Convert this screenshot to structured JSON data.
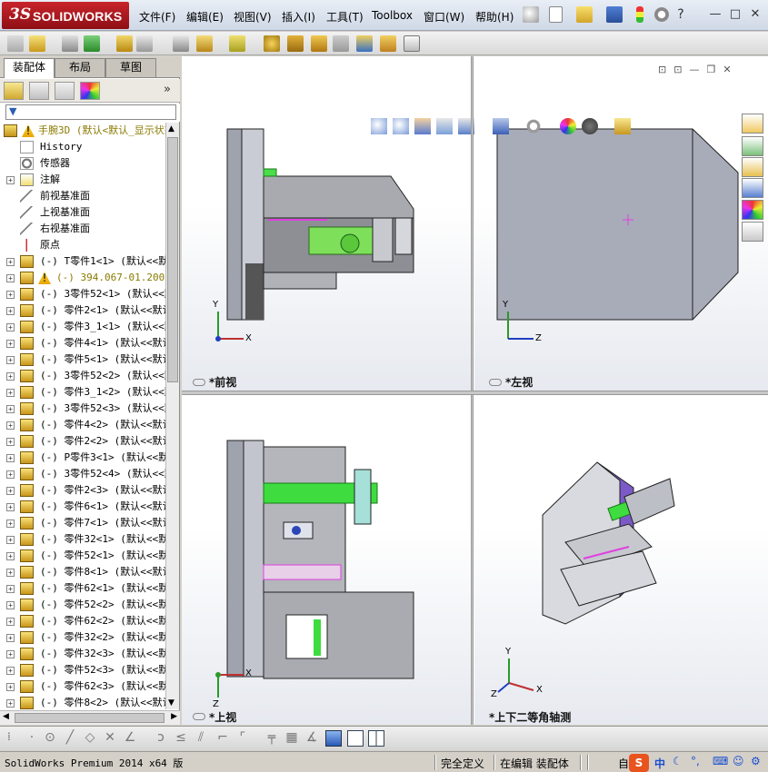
{
  "app": {
    "logo_ds": "3S",
    "logo_text": "SOLIDWORKS"
  },
  "menu": [
    {
      "label": "文件(F)"
    },
    {
      "label": "编辑(E)"
    },
    {
      "label": "视图(V)"
    },
    {
      "label": "插入(I)"
    },
    {
      "label": "工具(T)"
    },
    {
      "label": "Toolbox"
    },
    {
      "label": "窗口(W)"
    },
    {
      "label": "帮助(H)"
    }
  ],
  "window_controls": {
    "minimize": "—",
    "restore": "□",
    "close": "✕"
  },
  "panel_tabs": [
    {
      "label": "装配体",
      "active": true
    },
    {
      "label": "布局",
      "active": false
    },
    {
      "label": "草图",
      "active": false
    }
  ],
  "feature_tree": {
    "root": {
      "label": "手腕3D  (默认<默认_显示状态>",
      "icon": "assembly-warning-icon"
    },
    "items": [
      {
        "label": "History",
        "icon": "history-icon",
        "indent": 1,
        "expander": false
      },
      {
        "label": "传感器",
        "icon": "sensor-icon",
        "indent": 1,
        "expander": false
      },
      {
        "label": "注解",
        "icon": "annotation-icon",
        "indent": 1,
        "expander": true
      },
      {
        "label": "前视基准面",
        "icon": "plane-icon",
        "indent": 1,
        "expander": false
      },
      {
        "label": "上视基准面",
        "icon": "plane-icon",
        "indent": 1,
        "expander": false
      },
      {
        "label": "右视基准面",
        "icon": "plane-icon",
        "indent": 1,
        "expander": false
      },
      {
        "label": "原点",
        "icon": "origin-icon",
        "indent": 1,
        "expander": false
      },
      {
        "label": "(-) T零件1<1> (默认<<默",
        "icon": "part-icon",
        "indent": 1,
        "expander": true
      },
      {
        "label": "(-) 394.067-01.200.5(",
        "icon": "part-warning-icon",
        "indent": 1,
        "expander": true,
        "warning": true
      },
      {
        "label": "(-) 3零件52<1> (默认<<默",
        "icon": "part-icon",
        "indent": 1,
        "expander": true
      },
      {
        "label": "(-) 零件2<1> (默认<<默认",
        "icon": "part-icon",
        "indent": 1,
        "expander": true
      },
      {
        "label": "(-) 零件3_1<1> (默认<<默",
        "icon": "part-icon",
        "indent": 1,
        "expander": true
      },
      {
        "label": "(-) 零件4<1> (默认<<默认",
        "icon": "part-icon",
        "indent": 1,
        "expander": true
      },
      {
        "label": "(-) 零件5<1> (默认<<默认",
        "icon": "part-icon",
        "indent": 1,
        "expander": true
      },
      {
        "label": "(-) 3零件52<2> (默认<<默",
        "icon": "part-icon",
        "indent": 1,
        "expander": true
      },
      {
        "label": "(-) 零件3_1<2> (默认<<默",
        "icon": "part-icon",
        "indent": 1,
        "expander": true
      },
      {
        "label": "(-) 3零件52<3> (默认<<默",
        "icon": "part-icon",
        "indent": 1,
        "expander": true
      },
      {
        "label": "(-) 零件4<2> (默认<<默认",
        "icon": "part-icon",
        "indent": 1,
        "expander": true
      },
      {
        "label": "(-) 零件2<2> (默认<<默认",
        "icon": "part-icon",
        "indent": 1,
        "expander": true
      },
      {
        "label": "(-) P零件3<1> (默认<<默",
        "icon": "part-icon",
        "indent": 1,
        "expander": true
      },
      {
        "label": "(-) 3零件52<4> (默认<<默",
        "icon": "part-icon",
        "indent": 1,
        "expander": true
      },
      {
        "label": "(-) 零件2<3> (默认<<默认",
        "icon": "part-icon",
        "indent": 1,
        "expander": true
      },
      {
        "label": "(-) 零件6<1> (默认<<默认",
        "icon": "part-icon",
        "indent": 1,
        "expander": true
      },
      {
        "label": "(-) 零件7<1> (默认<<默认",
        "icon": "part-icon",
        "indent": 1,
        "expander": true
      },
      {
        "label": "(-) 零件32<1> (默认<<默",
        "icon": "part-icon",
        "indent": 1,
        "expander": true
      },
      {
        "label": "(-) 零件52<1> (默认<<默",
        "icon": "part-icon",
        "indent": 1,
        "expander": true
      },
      {
        "label": "(-) 零件8<1> (默认<<默认",
        "icon": "part-icon",
        "indent": 1,
        "expander": true
      },
      {
        "label": "(-) 零件62<1> (默认<<默",
        "icon": "part-icon",
        "indent": 1,
        "expander": true
      },
      {
        "label": "(-) 零件52<2> (默认<<默",
        "icon": "part-icon",
        "indent": 1,
        "expander": true
      },
      {
        "label": "(-) 零件62<2> (默认<<默",
        "icon": "part-icon",
        "indent": 1,
        "expander": true
      },
      {
        "label": "(-) 零件32<2> (默认<<默",
        "icon": "part-icon",
        "indent": 1,
        "expander": true
      },
      {
        "label": "(-) 零件32<3> (默认<<默",
        "icon": "part-icon",
        "indent": 1,
        "expander": true
      },
      {
        "label": "(-) 零件52<3> (默认<<默",
        "icon": "part-icon",
        "indent": 1,
        "expander": true
      },
      {
        "label": "(-) 零件62<3> (默认<<默",
        "icon": "part-icon",
        "indent": 1,
        "expander": true
      },
      {
        "label": "(-) 零件8<2> (默认<<默认",
        "icon": "part-icon",
        "indent": 1,
        "expander": true
      }
    ]
  },
  "viewports": {
    "front": {
      "label": "*前视",
      "axis_x": "X",
      "axis_y": "Y"
    },
    "left": {
      "label": "*左视",
      "axis_x": "Z",
      "axis_y": "Y"
    },
    "top": {
      "label": "*上视",
      "axis_x": "X",
      "axis_y": "Z"
    },
    "iso": {
      "label": "*上下二等角轴测",
      "axis_x": "X",
      "axis_y": "Y",
      "axis_z": "Z"
    }
  },
  "status": {
    "app_version": "SolidWorks Premium 2014 x64 版",
    "definition": "完全定义",
    "mode": "在编辑 装配体",
    "custom": "自",
    "ime": "中"
  },
  "colors": {
    "accent_red": "#b81d24",
    "part_gray": "#9a9a9a",
    "part_green": "#3fdc3f",
    "part_purple": "#7b5ac8",
    "selection_magenta": "#e040e0"
  }
}
